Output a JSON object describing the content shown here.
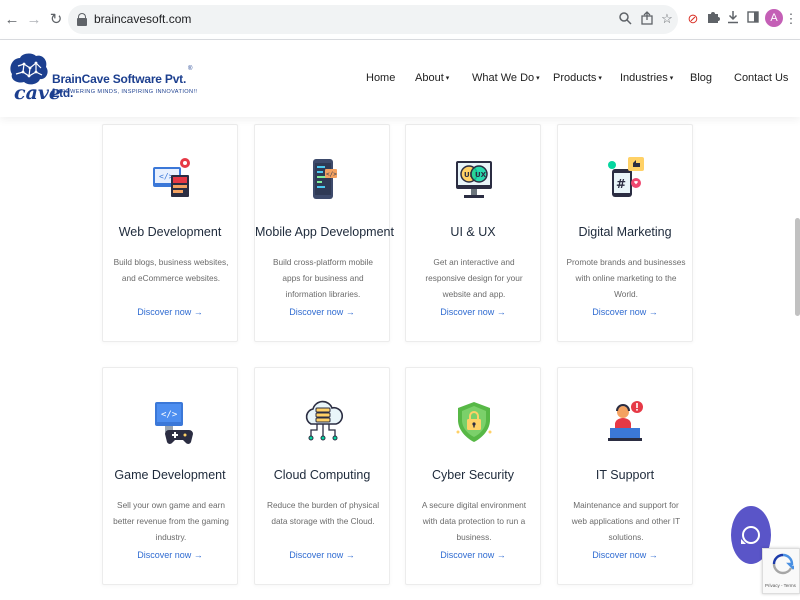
{
  "browser": {
    "url": "braincavesoft.com",
    "avatar_letter": "A"
  },
  "site": {
    "logo_name": "BrainCave Software Pvt. Ltd.",
    "logo_reg": "®",
    "logo_tagline": "EMPOWERING MINDS, INSPIRING INNOVATION!!",
    "logo_cave": "cave",
    "nav": [
      {
        "label": "Home",
        "dropdown": false
      },
      {
        "label": "About",
        "dropdown": true
      },
      {
        "label": "What We Do",
        "dropdown": true
      },
      {
        "label": "Products",
        "dropdown": true
      },
      {
        "label": "Industries",
        "dropdown": true
      },
      {
        "label": "Blog",
        "dropdown": false
      },
      {
        "label": "Contact Us",
        "dropdown": false
      }
    ]
  },
  "services": [
    {
      "title": "Web Development",
      "desc": "Build blogs, business websites, and eCommerce websites.",
      "link": "Discover now",
      "icon": "web-development-icon"
    },
    {
      "title": "Mobile App Development",
      "desc": "Build cross-platform mobile apps for business and information libraries.",
      "link": "Discover now",
      "icon": "mobile-app-icon"
    },
    {
      "title": "UI & UX",
      "desc": "Get an interactive and responsive design for your website and app.",
      "link": "Discover now",
      "icon": "ui-ux-icon"
    },
    {
      "title": "Digital Marketing",
      "desc": "Promote brands and businesses with online marketing to the World.",
      "link": "Discover now",
      "icon": "digital-marketing-icon"
    },
    {
      "title": "Game Development",
      "desc": "Sell your own game and earn better revenue from the gaming industry.",
      "link": "Discover now",
      "icon": "game-development-icon"
    },
    {
      "title": "Cloud Computing",
      "desc": "Reduce the burden of physical data storage with the Cloud.",
      "link": "Discover now",
      "icon": "cloud-computing-icon"
    },
    {
      "title": "Cyber Security",
      "desc": "A secure digital environment with data protection to run a business.",
      "link": "Discover now",
      "icon": "cyber-security-icon"
    },
    {
      "title": "IT Support",
      "desc": "Maintenance and support for web applications and other IT solutions.",
      "link": "Discover now",
      "icon": "it-support-icon"
    }
  ],
  "recaptcha": {
    "text": "Privacy - Terms"
  },
  "colors": {
    "brand": "#1c3f8f",
    "link": "#2f6bd1",
    "chat": "#5a55c8"
  }
}
